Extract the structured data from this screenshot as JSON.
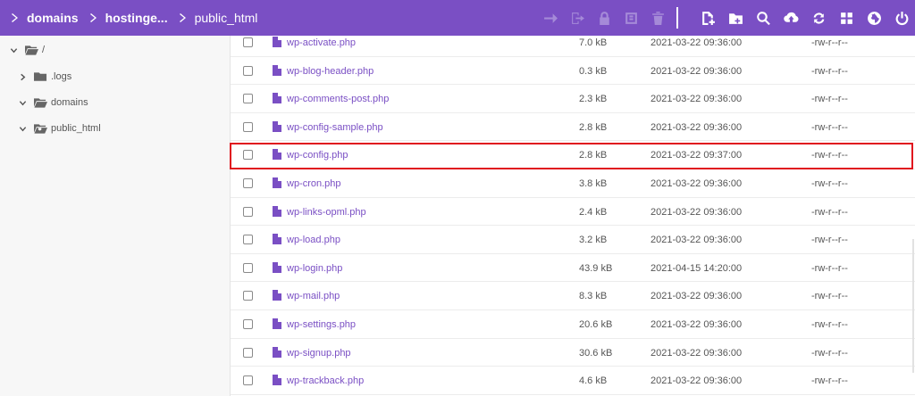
{
  "breadcrumb": [
    {
      "label": "domains"
    },
    {
      "label": "hostinge..."
    },
    {
      "label": "public_html"
    }
  ],
  "toolbar": {
    "left_icons": [
      "move-icon",
      "rename-icon",
      "lock-icon",
      "archive-icon",
      "trash-icon"
    ],
    "right_icons": [
      "new-file-icon",
      "new-folder-icon",
      "search-icon",
      "upload-icon",
      "refresh-icon",
      "grid-view-icon",
      "globe-icon",
      "power-icon"
    ],
    "disabled_color": "#a58ad8",
    "active_color": "#ffffff"
  },
  "sidebar": {
    "items": [
      {
        "label": "/",
        "expanded": true,
        "icon": "folder-open-icon"
      },
      {
        "label": ".logs",
        "expanded": false,
        "icon": "folder-icon"
      },
      {
        "label": "domains",
        "expanded": true,
        "icon": "folder-open-icon"
      },
      {
        "label": "public_html",
        "expanded": true,
        "icon": "folder-link-icon"
      }
    ]
  },
  "files": [
    {
      "name": "wp-activate.php",
      "size": "7.0 kB",
      "modified": "2021-03-22 09:36:00",
      "perms": "-rw-r--r--"
    },
    {
      "name": "wp-blog-header.php",
      "size": "0.3 kB",
      "modified": "2021-03-22 09:36:00",
      "perms": "-rw-r--r--"
    },
    {
      "name": "wp-comments-post.php",
      "size": "2.3 kB",
      "modified": "2021-03-22 09:36:00",
      "perms": "-rw-r--r--"
    },
    {
      "name": "wp-config-sample.php",
      "size": "2.8 kB",
      "modified": "2021-03-22 09:36:00",
      "perms": "-rw-r--r--"
    },
    {
      "name": "wp-config.php",
      "size": "2.8 kB",
      "modified": "2021-03-22 09:37:00",
      "perms": "-rw-r--r--",
      "highlighted": true
    },
    {
      "name": "wp-cron.php",
      "size": "3.8 kB",
      "modified": "2021-03-22 09:36:00",
      "perms": "-rw-r--r--"
    },
    {
      "name": "wp-links-opml.php",
      "size": "2.4 kB",
      "modified": "2021-03-22 09:36:00",
      "perms": "-rw-r--r--"
    },
    {
      "name": "wp-load.php",
      "size": "3.2 kB",
      "modified": "2021-03-22 09:36:00",
      "perms": "-rw-r--r--"
    },
    {
      "name": "wp-login.php",
      "size": "43.9 kB",
      "modified": "2021-04-15 14:20:00",
      "perms": "-rw-r--r--"
    },
    {
      "name": "wp-mail.php",
      "size": "8.3 kB",
      "modified": "2021-03-22 09:36:00",
      "perms": "-rw-r--r--"
    },
    {
      "name": "wp-settings.php",
      "size": "20.6 kB",
      "modified": "2021-03-22 09:36:00",
      "perms": "-rw-r--r--"
    },
    {
      "name": "wp-signup.php",
      "size": "30.6 kB",
      "modified": "2021-03-22 09:36:00",
      "perms": "-rw-r--r--"
    },
    {
      "name": "wp-trackback.php",
      "size": "4.6 kB",
      "modified": "2021-03-22 09:36:00",
      "perms": "-rw-r--r--"
    }
  ],
  "colors": {
    "header_bg": "#7a4fc4",
    "file_link": "#7a4fc4",
    "highlight_border": "#e0141e"
  }
}
